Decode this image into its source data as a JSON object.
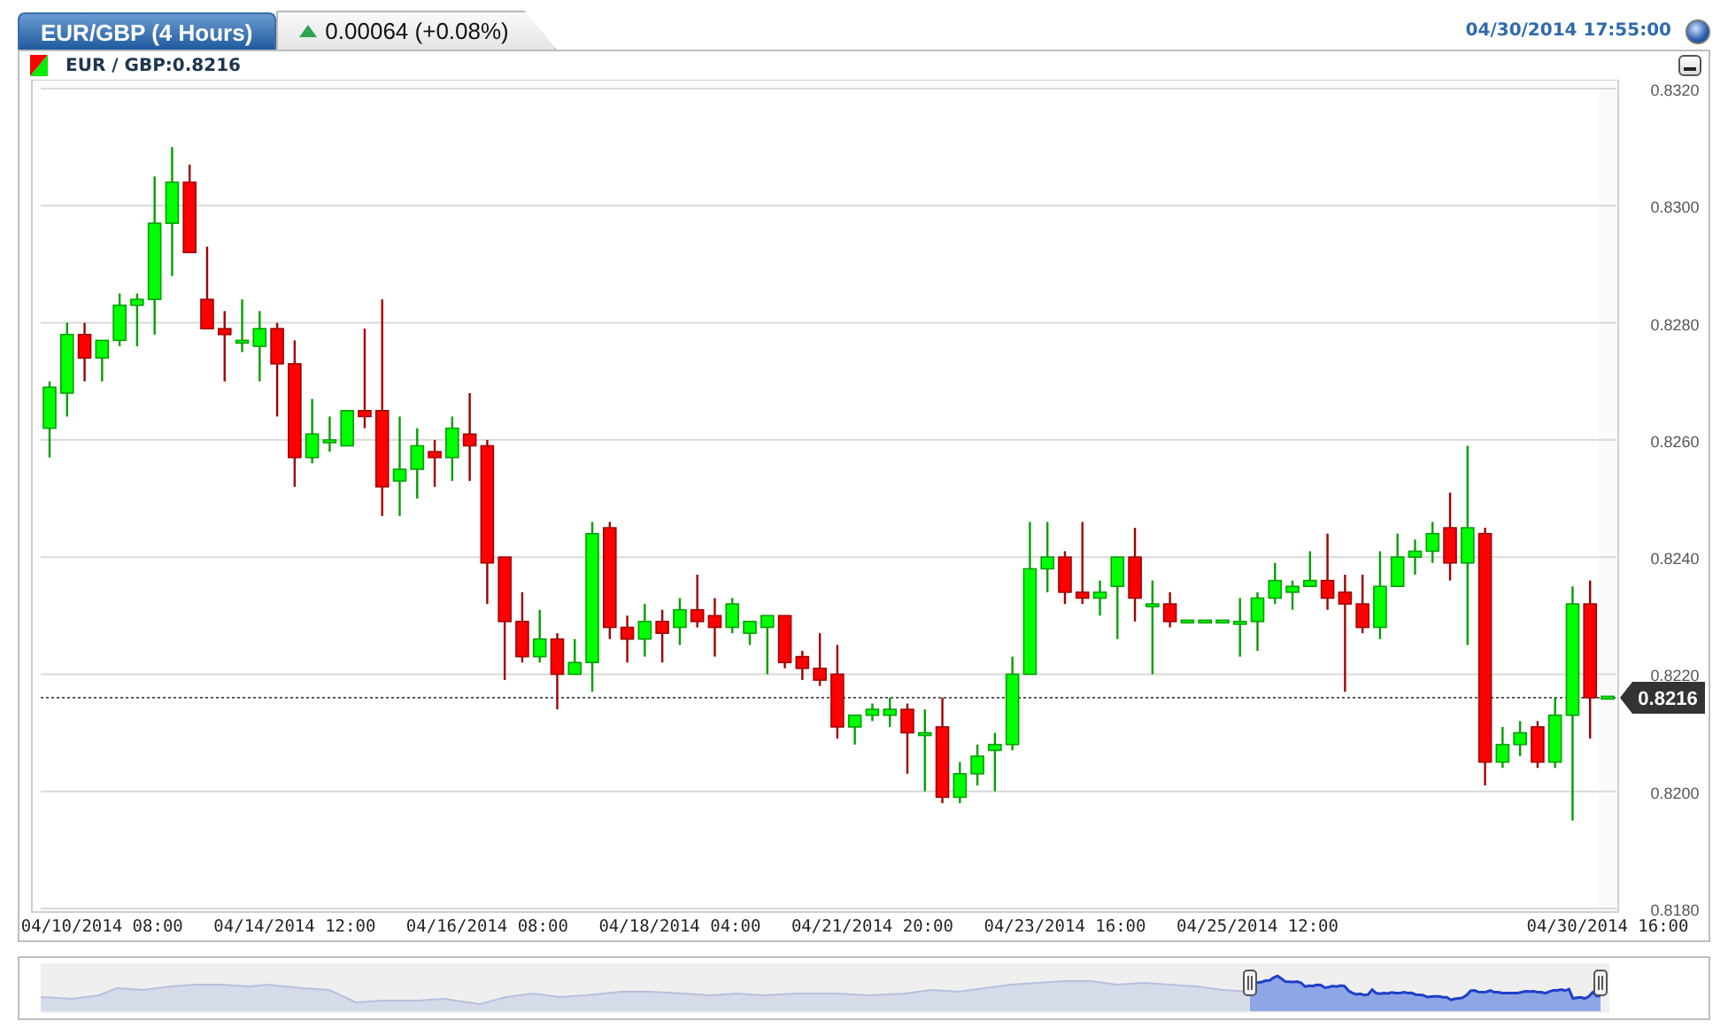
{
  "header": {
    "tabs": [
      {
        "label": "EUR/GBP (4 Hours)",
        "selected": true
      }
    ],
    "change": {
      "text": "0.00064 (+0.08%)",
      "rising": true
    },
    "timestamp": "04/30/2014 17:55:00"
  },
  "legend": {
    "label": "EUR / GBP:0.8216"
  },
  "chart": {
    "current_price": "0.8216",
    "chart_data": {
      "type": "candlestick",
      "ylim": [
        0.818,
        0.832
      ],
      "grid": true,
      "ref_lines": [
        {
          "axis": "y",
          "value": 0.8216
        }
      ],
      "yticks": [
        {
          "value": 0.818,
          "label": "0.8180"
        },
        {
          "value": 0.82,
          "label": "0.8200"
        },
        {
          "value": 0.822,
          "label": "0.8220"
        },
        {
          "value": 0.824,
          "label": "0.8240"
        },
        {
          "value": 0.826,
          "label": "0.8260"
        },
        {
          "value": 0.828,
          "label": "0.8280"
        },
        {
          "value": 0.83,
          "label": "0.8300"
        },
        {
          "value": 0.832,
          "label": "0.8320"
        }
      ],
      "categories": [
        null,
        null,
        null,
        "04/10/2014 08:00",
        null,
        null,
        null,
        null,
        null,
        null,
        null,
        null,
        null,
        null,
        "04/14/2014 12:00",
        null,
        null,
        null,
        null,
        null,
        null,
        null,
        null,
        null,
        null,
        "04/16/2014 08:00",
        null,
        null,
        null,
        null,
        null,
        null,
        null,
        null,
        null,
        null,
        "04/18/2014 04:00",
        null,
        null,
        null,
        null,
        null,
        null,
        null,
        null,
        null,
        null,
        "04/21/2014 20:00",
        null,
        null,
        null,
        null,
        null,
        null,
        null,
        null,
        null,
        null,
        "04/23/2014 16:00",
        null,
        null,
        null,
        null,
        null,
        null,
        null,
        null,
        null,
        null,
        "04/25/2014 12:00",
        null,
        null,
        null,
        null,
        null,
        null,
        null,
        null,
        null,
        null,
        null,
        null,
        null,
        null,
        null,
        null,
        null,
        null,
        null,
        "04/30/2014 16:00"
      ],
      "ohlc": [
        [
          0.8262,
          0.827,
          0.8257,
          0.8269
        ],
        [
          0.8268,
          0.828,
          0.8264,
          0.8278
        ],
        [
          0.8278,
          0.828,
          0.827,
          0.8274
        ],
        [
          0.8274,
          0.8277,
          0.827,
          0.8277
        ],
        [
          0.8277,
          0.8285,
          0.8276,
          0.8283
        ],
        [
          0.8283,
          0.8285,
          0.8276,
          0.8284
        ],
        [
          0.8284,
          0.8305,
          0.8278,
          0.8297
        ],
        [
          0.8297,
          0.831,
          0.8288,
          0.8304
        ],
        [
          0.8304,
          0.8307,
          0.8292,
          0.8292
        ],
        [
          0.8284,
          0.8293,
          0.8279,
          0.8279
        ],
        [
          0.8279,
          0.8282,
          0.827,
          0.8278
        ],
        [
          0.8277,
          0.8284,
          0.8275,
          0.8277
        ],
        [
          0.8276,
          0.8282,
          0.827,
          0.8279
        ],
        [
          0.8279,
          0.828,
          0.8264,
          0.8273
        ],
        [
          0.8273,
          0.8277,
          0.8252,
          0.8257
        ],
        [
          0.8257,
          0.8267,
          0.8256,
          0.8261
        ],
        [
          0.826,
          0.8264,
          0.8258,
          0.826
        ],
        [
          0.8259,
          0.8265,
          0.8259,
          0.8265
        ],
        [
          0.8265,
          0.8279,
          0.8262,
          0.8264
        ],
        [
          0.8265,
          0.8284,
          0.8247,
          0.8252
        ],
        [
          0.8253,
          0.8264,
          0.8247,
          0.8255
        ],
        [
          0.8255,
          0.8262,
          0.825,
          0.8259
        ],
        [
          0.8258,
          0.826,
          0.8252,
          0.8257
        ],
        [
          0.8257,
          0.8264,
          0.8253,
          0.8262
        ],
        [
          0.8261,
          0.8268,
          0.8253,
          0.8259
        ],
        [
          0.8259,
          0.826,
          0.8232,
          0.8239
        ],
        [
          0.824,
          0.824,
          0.8219,
          0.8229
        ],
        [
          0.8229,
          0.8234,
          0.8222,
          0.8223
        ],
        [
          0.8223,
          0.8231,
          0.8222,
          0.8226
        ],
        [
          0.8226,
          0.8227,
          0.8214,
          0.822
        ],
        [
          0.822,
          0.8226,
          0.822,
          0.8222
        ],
        [
          0.8222,
          0.8246,
          0.8217,
          0.8244
        ],
        [
          0.8245,
          0.8246,
          0.8226,
          0.8228
        ],
        [
          0.8228,
          0.823,
          0.8222,
          0.8226
        ],
        [
          0.8226,
          0.8232,
          0.8223,
          0.8229
        ],
        [
          0.8229,
          0.8231,
          0.8222,
          0.8227
        ],
        [
          0.8228,
          0.8233,
          0.8225,
          0.8231
        ],
        [
          0.8231,
          0.8237,
          0.8228,
          0.8229
        ],
        [
          0.823,
          0.8233,
          0.8223,
          0.8228
        ],
        [
          0.8228,
          0.8233,
          0.8227,
          0.8232
        ],
        [
          0.8227,
          0.8229,
          0.8225,
          0.8229
        ],
        [
          0.8228,
          0.823,
          0.822,
          0.823
        ],
        [
          0.823,
          0.823,
          0.8221,
          0.8222
        ],
        [
          0.8223,
          0.8224,
          0.8219,
          0.8221
        ],
        [
          0.8221,
          0.8227,
          0.8218,
          0.8219
        ],
        [
          0.822,
          0.8225,
          0.8209,
          0.8211
        ],
        [
          0.8211,
          0.8213,
          0.8208,
          0.8213
        ],
        [
          0.8213,
          0.8215,
          0.8212,
          0.8214
        ],
        [
          0.8213,
          0.8216,
          0.8211,
          0.8214
        ],
        [
          0.8214,
          0.8215,
          0.8203,
          0.821
        ],
        [
          0.821,
          0.8214,
          0.82,
          0.821
        ],
        [
          0.8211,
          0.8216,
          0.8198,
          0.8199
        ],
        [
          0.8199,
          0.8205,
          0.8198,
          0.8203
        ],
        [
          0.8203,
          0.8208,
          0.8201,
          0.8206
        ],
        [
          0.8207,
          0.821,
          0.82,
          0.8208
        ],
        [
          0.8208,
          0.8223,
          0.8207,
          0.822
        ],
        [
          0.822,
          0.8246,
          0.822,
          0.8238
        ],
        [
          0.8238,
          0.8246,
          0.8234,
          0.824
        ],
        [
          0.824,
          0.8241,
          0.8232,
          0.8234
        ],
        [
          0.8234,
          0.8246,
          0.8232,
          0.8233
        ],
        [
          0.8233,
          0.8236,
          0.823,
          0.8234
        ],
        [
          0.8235,
          0.824,
          0.8226,
          0.824
        ],
        [
          0.824,
          0.8245,
          0.8229,
          0.8233
        ],
        [
          0.8232,
          0.8236,
          0.822,
          0.8232
        ],
        [
          0.8232,
          0.8234,
          0.8228,
          0.8229
        ],
        [
          0.8229,
          0.8229,
          0.8229,
          0.8229
        ],
        [
          0.8229,
          0.8229,
          0.8229,
          0.8229
        ],
        [
          0.8229,
          0.8229,
          0.8229,
          0.8229
        ],
        [
          0.8229,
          0.8233,
          0.8223,
          0.8229
        ],
        [
          0.8229,
          0.8234,
          0.8224,
          0.8233
        ],
        [
          0.8233,
          0.8239,
          0.8232,
          0.8236
        ],
        [
          0.8234,
          0.8236,
          0.8231,
          0.8235
        ],
        [
          0.8235,
          0.8241,
          0.8235,
          0.8236
        ],
        [
          0.8236,
          0.8244,
          0.8231,
          0.8233
        ],
        [
          0.8234,
          0.8237,
          0.8217,
          0.8232
        ],
        [
          0.8232,
          0.8237,
          0.8227,
          0.8228
        ],
        [
          0.8228,
          0.8241,
          0.8226,
          0.8235
        ],
        [
          0.8235,
          0.8244,
          0.8235,
          0.824
        ],
        [
          0.824,
          0.8243,
          0.8237,
          0.8241
        ],
        [
          0.8241,
          0.8246,
          0.8239,
          0.8244
        ],
        [
          0.8245,
          0.8251,
          0.8236,
          0.8239
        ],
        [
          0.8239,
          0.8259,
          0.8225,
          0.8245
        ],
        [
          0.8244,
          0.8245,
          0.8201,
          0.8205
        ],
        [
          0.8205,
          0.8211,
          0.8204,
          0.8208
        ],
        [
          0.8208,
          0.8212,
          0.8206,
          0.821
        ],
        [
          0.8211,
          0.8212,
          0.8204,
          0.8205
        ],
        [
          0.8205,
          0.8216,
          0.8204,
          0.8213
        ],
        [
          0.8213,
          0.8235,
          0.8195,
          0.8232
        ],
        [
          0.8232,
          0.8236,
          0.8209,
          0.8216
        ],
        [
          0.8216,
          0.8216,
          0.8216,
          0.8216
        ]
      ]
    }
  }
}
